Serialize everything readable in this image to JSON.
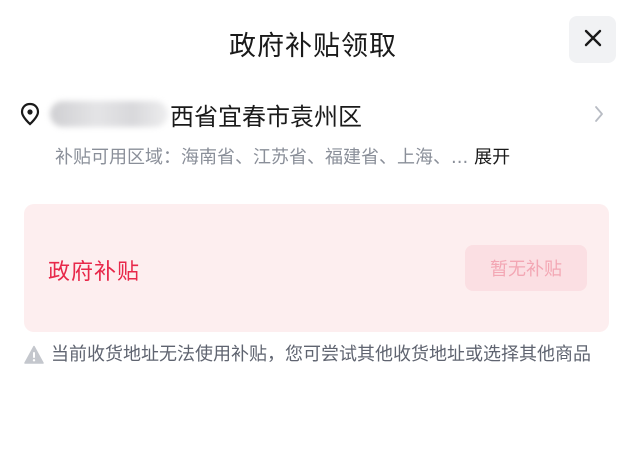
{
  "dialog": {
    "title": "政府补贴领取",
    "close_icon": "close-icon"
  },
  "address": {
    "text": "西省宜春市袁州区",
    "pin_icon": "location-pin-icon",
    "chevron_icon": "chevron-right-icon"
  },
  "region": {
    "label": "补贴可用区域：",
    "list": "海南省、江苏省、福建省、上海、...",
    "expand": "展开"
  },
  "subsidy": {
    "title": "政府补贴",
    "button_label": "暂无补贴",
    "title_color": "#e8284a",
    "card_color": "#fdeeef"
  },
  "notice": {
    "icon": "warning-icon",
    "text": "当前收货地址无法使用补贴，您可尝试其他收货地址或选择其他商品"
  }
}
